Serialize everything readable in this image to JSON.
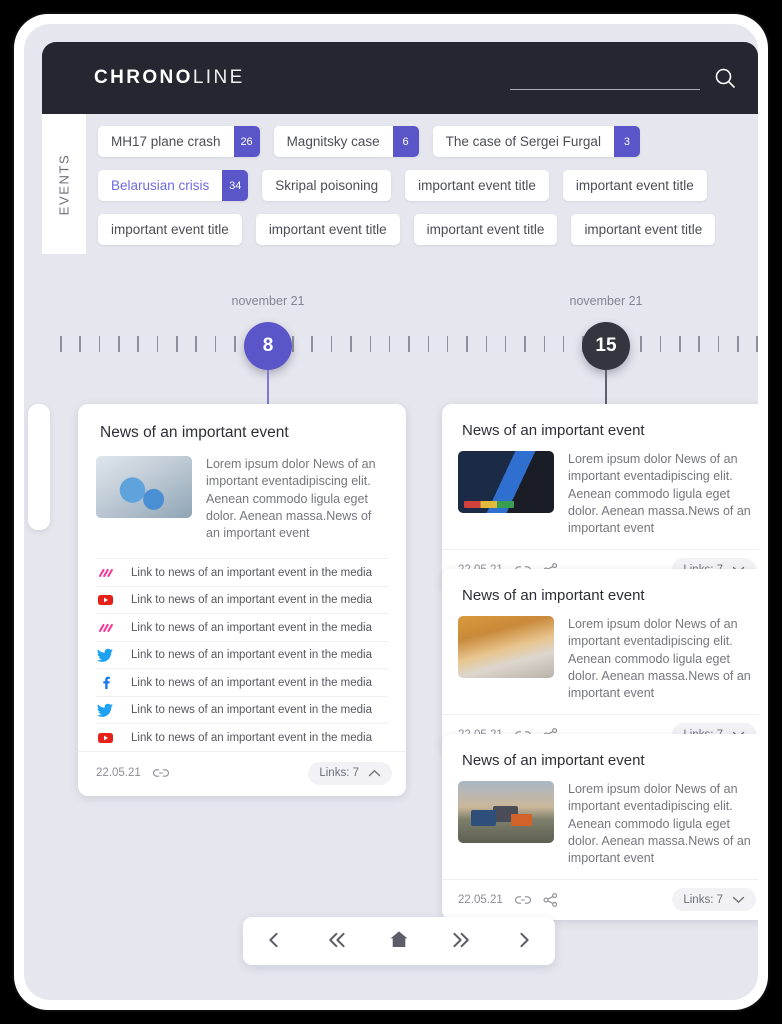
{
  "brand": {
    "strong": "CHRONO",
    "light": "LINE"
  },
  "search": {
    "value": "",
    "placeholder": "",
    "icon": "search-icon"
  },
  "events": {
    "tab_label": "EVENTS",
    "tags": [
      {
        "label": "MH17 plane crash",
        "count": "26",
        "active": false
      },
      {
        "label": "Magnitsky case",
        "count": "6",
        "active": false
      },
      {
        "label": "The case of Sergei Furgal",
        "count": "3",
        "active": false
      },
      {
        "label": "Belarusian crisis",
        "count": "34",
        "active": true
      },
      {
        "label": "Skripal poisoning",
        "count": "",
        "active": false
      },
      {
        "label": "important event title",
        "count": "",
        "active": false
      },
      {
        "label": "important event title",
        "count": "",
        "active": false
      },
      {
        "label": "important event title",
        "count": "",
        "active": false
      },
      {
        "label": "important event title",
        "count": "",
        "active": false
      },
      {
        "label": "important event title",
        "count": "",
        "active": false
      },
      {
        "label": "important event title",
        "count": "",
        "active": false
      }
    ]
  },
  "timeline": {
    "markers": [
      {
        "day": "8",
        "date": "november 21",
        "color": "#5a55c8"
      },
      {
        "day": "15",
        "date": "november 21",
        "color": "#34353f"
      }
    ]
  },
  "main_card": {
    "title": "News of an important event",
    "text": "Lorem ipsum dolor News of an important eventadipiscing elit. Aenean commodo ligula eget dolor. Aenean massa.News of an important event",
    "thumb": "lab-gloves-photo",
    "links": [
      {
        "source": "meduza-icon",
        "label": "Link to news of an important event in the media"
      },
      {
        "source": "youtube-icon",
        "label": "Link to news of an important event in the media"
      },
      {
        "source": "meduza-icon",
        "label": "Link to news of an important event in the media"
      },
      {
        "source": "twitter-icon",
        "label": "Link to news of an important event in the media"
      },
      {
        "source": "facebook-icon",
        "label": "Link to news of an important event in the media"
      },
      {
        "source": "twitter-icon",
        "label": "Link to news of an important event in the media"
      },
      {
        "source": "youtube-icon",
        "label": "Link to news of an important event in the media"
      }
    ],
    "date": "22.05.21",
    "links_chip": "Links: 7",
    "chip_state": "expanded"
  },
  "side_cards": [
    {
      "title": "News of an important event",
      "text": "Lorem ipsum dolor News of an important eventadipiscing elit. Aenean commodo ligula eget dolor. Aenean massa.News of an important event",
      "thumb": "pos-terminal-photo",
      "date": "22.05.21",
      "links_chip": "Links: 7"
    },
    {
      "title": "News of an important event",
      "text": "Lorem ipsum dolor News of an important eventadipiscing elit. Aenean commodo ligula eget dolor. Aenean massa.News of an important event",
      "thumb": "orange-sky-photo",
      "date": "22.05.21",
      "links_chip": "Links: 7"
    },
    {
      "title": "News of an important event",
      "text": "Lorem ipsum dolor News of an important eventadipiscing elit. Aenean commodo ligula eget dolor. Aenean massa.News of an important event",
      "thumb": "dump-trucks-photo",
      "date": "22.05.21",
      "links_chip": "Links: 7"
    }
  ],
  "bottom_nav": [
    {
      "icon": "chevron-left-icon",
      "name": "previous-button"
    },
    {
      "icon": "double-chevron-left-icon",
      "name": "fast-previous-button"
    },
    {
      "icon": "home-icon",
      "name": "home-button"
    },
    {
      "icon": "double-chevron-right-icon",
      "name": "fast-next-button"
    },
    {
      "icon": "chevron-right-icon",
      "name": "next-button"
    }
  ],
  "colors": {
    "accent_purple": "#5a55c8",
    "dark_navy": "#25262f",
    "page_bg": "#e6e6ee",
    "active_tag_text": "#6f6be0"
  }
}
